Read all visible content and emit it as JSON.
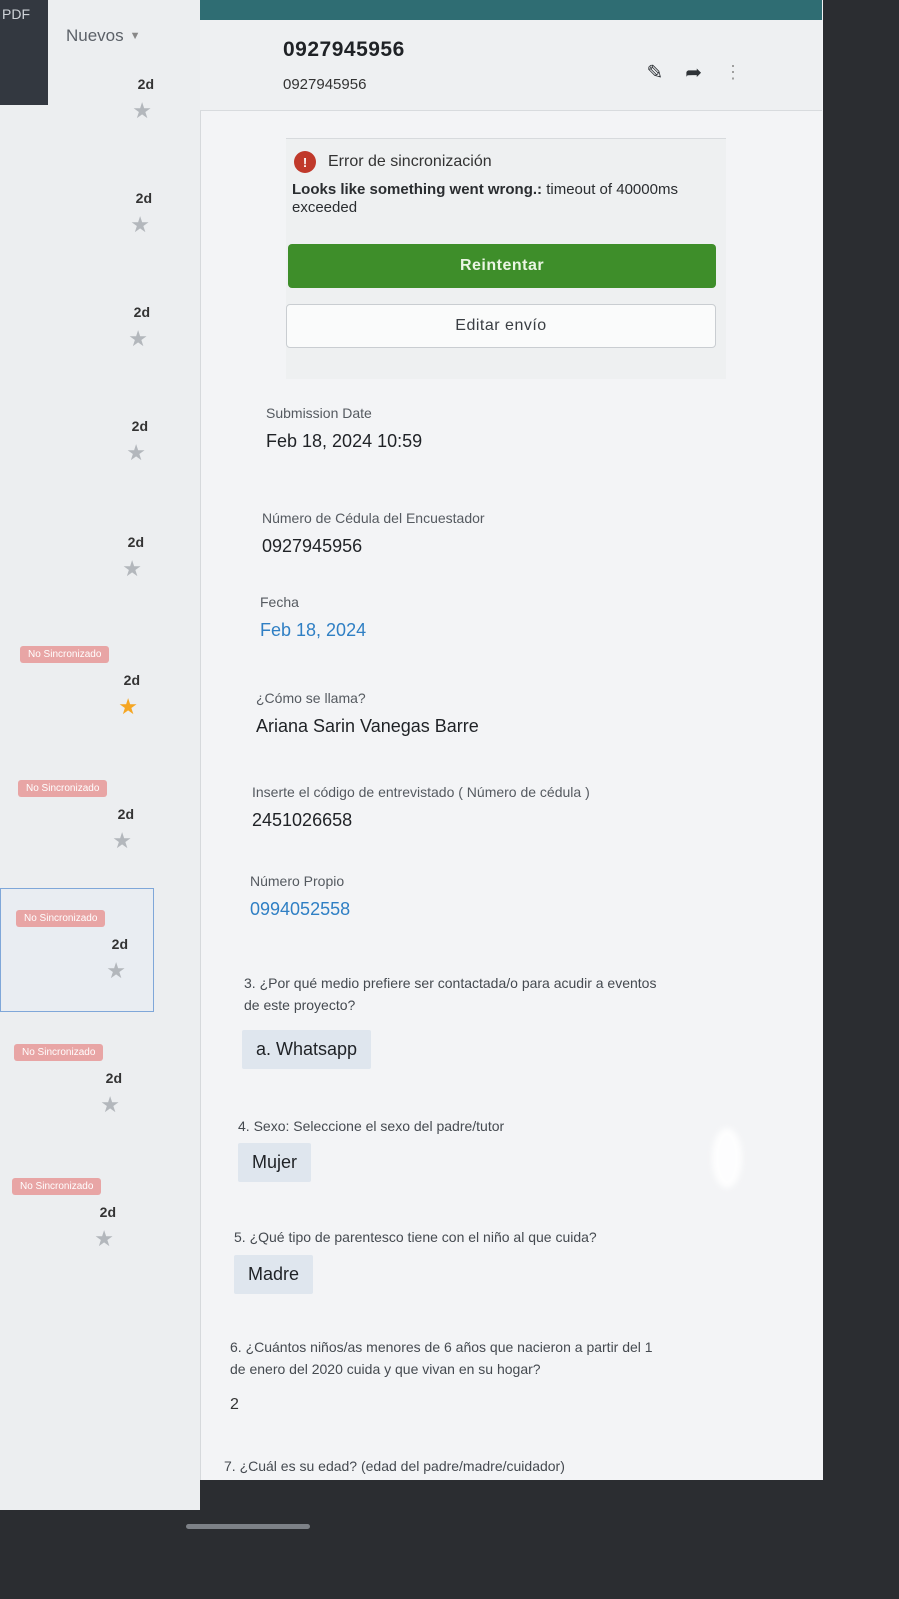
{
  "sidebar": {
    "corner_label": "PDF",
    "folder": "Nuevos",
    "items": [
      {
        "time": "2d",
        "badge": "",
        "starred": false
      },
      {
        "time": "2d",
        "badge": "",
        "starred": false
      },
      {
        "time": "2d",
        "badge": "",
        "starred": false
      },
      {
        "time": "2d",
        "badge": "",
        "starred": false
      },
      {
        "time": "2d",
        "badge": "",
        "starred": false
      },
      {
        "time": "2d",
        "badge": "No Sincronizado",
        "starred": true
      },
      {
        "time": "2d",
        "badge": "No Sincronizado",
        "starred": false
      },
      {
        "time": "2d",
        "badge": "No Sincronizado",
        "starred": false
      },
      {
        "time": "2d",
        "badge": "No Sincronizado",
        "starred": false
      },
      {
        "time": "2d",
        "badge": "No Sincronizado",
        "starred": false
      }
    ]
  },
  "header": {
    "title": "0927945956",
    "subtitle": "0927945956",
    "icons": [
      "edit-icon",
      "forward-icon",
      "more-icon"
    ]
  },
  "error": {
    "title": "Error de sincronización",
    "message_bold": "Looks like something went wrong.:",
    "message_rest": " timeout of 40000ms exceeded",
    "retry_label": "Reintentar",
    "edit_label": "Editar envío"
  },
  "fields": {
    "submission_date": {
      "label": "Submission Date",
      "value": "Feb 18, 2024 10:59"
    },
    "cedula_encuestador": {
      "label": "Número de Cédula del Encuestador",
      "value": "0927945956"
    },
    "fecha": {
      "label": "Fecha",
      "value": "Feb 18, 2024"
    },
    "nombre": {
      "label": "¿Cómo se llama?",
      "value": "Ariana Sarin  Vanegas Barre"
    },
    "codigo": {
      "label": "Inserte el código de entrevistado ( Número de cédula )",
      "value": "2451026658"
    },
    "numero_propio": {
      "label": "Número Propio",
      "value": "0994052558"
    }
  },
  "questions": {
    "q3": {
      "text": "3. ¿Por qué medio prefiere ser contactada/o para acudir a eventos de este proyecto?",
      "answer": "a. Whatsapp"
    },
    "q4": {
      "text": "4. Sexo: Seleccione el sexo del padre/tutor",
      "answer": "Mujer"
    },
    "q5": {
      "text": "5. ¿Qué tipo de parentesco tiene con el niño al que cuida?",
      "answer": "Madre"
    },
    "q6": {
      "text": "6. ¿Cuántos niños/as menores de 6 años que nacieron a partir del 1 de enero del 2020 cuida y que vivan en su hogar?",
      "answer": "2"
    },
    "q7": {
      "text": "7. ¿Cuál es su edad? (edad del padre/madre/cuidador)"
    }
  },
  "colors": {
    "accent_green": "#3e8e2a",
    "link_blue": "#2f7fc4",
    "badge": "#e8a5a5",
    "star_fav": "#f5a623"
  }
}
